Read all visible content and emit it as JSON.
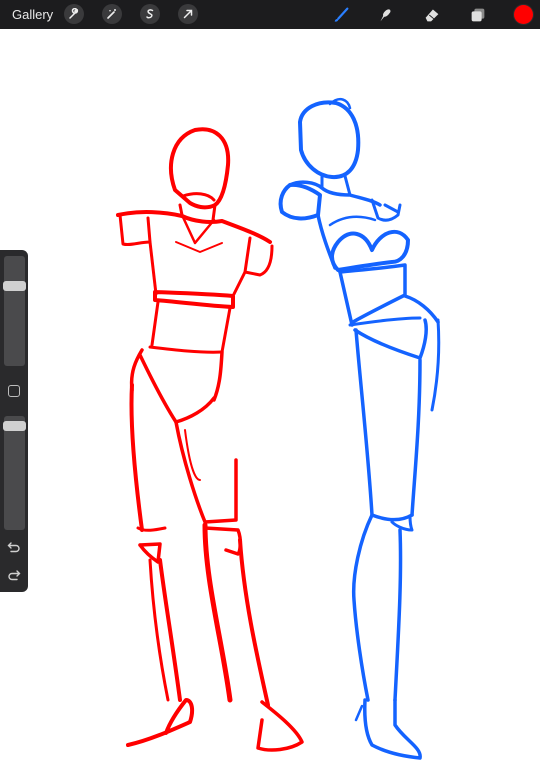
{
  "topbar": {
    "gallery_label": "Gallery",
    "left_tools": [
      "wrench-icon",
      "magic-wand-icon",
      "selection-icon",
      "transform-arrow-icon"
    ],
    "right_tools": [
      "brush-icon",
      "smudge-icon",
      "eraser-icon",
      "layers-icon"
    ],
    "active_tool": "brush-icon",
    "active_tool_color": "#2a7fff",
    "current_color": "#ff0000"
  },
  "sidebar": {
    "brush_size_level": 0.78,
    "opacity_level": 0.98,
    "buttons": [
      "modify-square-icon",
      "undo-icon",
      "redo-icon"
    ]
  },
  "canvas": {
    "stroke_colors": [
      "#ff0000",
      "#1463ff"
    ]
  }
}
